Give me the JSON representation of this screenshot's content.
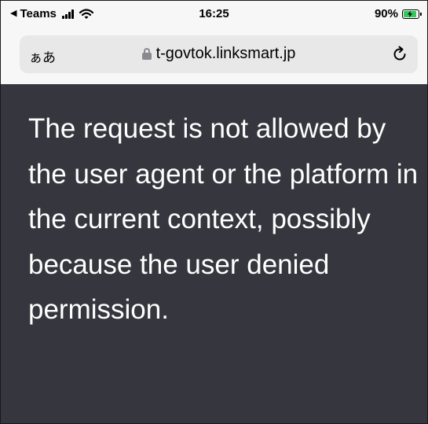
{
  "status_bar": {
    "back_app": "Teams",
    "time": "16:25",
    "battery_percent": "90%",
    "battery_level": 0.9,
    "icons": [
      "back-arrow-icon",
      "cellular-signal-icon",
      "wifi-icon",
      "battery-charging-icon"
    ]
  },
  "address_bar": {
    "text_size_label": "ぁあ",
    "url": "t-govtok.linksmart.jp",
    "icons": [
      "lock-icon",
      "reload-icon"
    ]
  },
  "content": {
    "message": "The request is not allowed by the user agent or the platform in the current context, possibly because the user denied permission."
  },
  "colors": {
    "content_background": "#36363e",
    "message_text": "#ffffff",
    "chrome_background": "#f7f7f7",
    "address_bar_background": "#e8e8e9",
    "battery_fill": "#34c759"
  }
}
